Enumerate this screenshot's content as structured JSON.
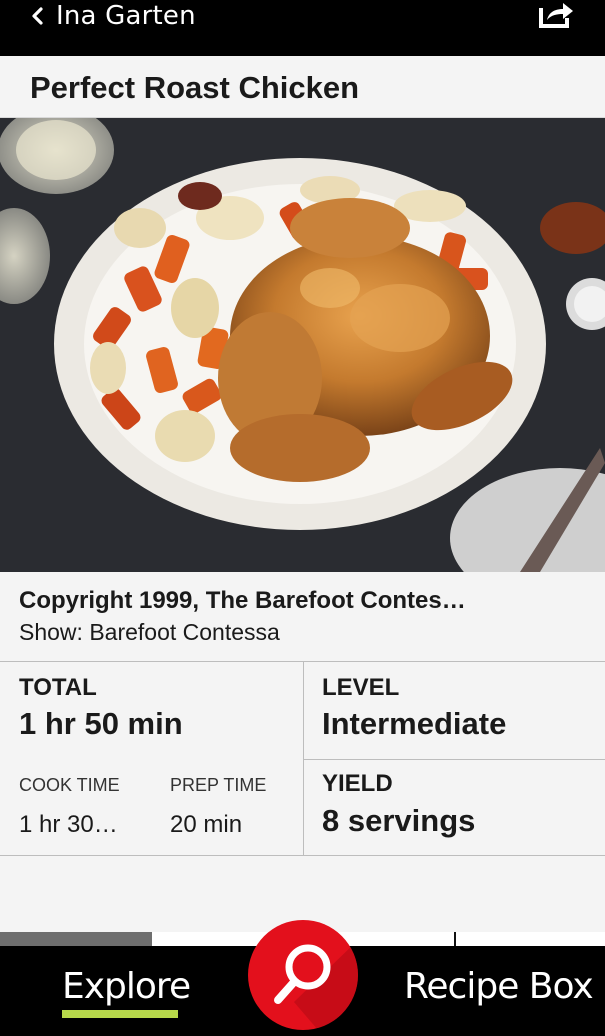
{
  "nav": {
    "back_label": "Ina Garten",
    "back_icon": "chevron-left-icon",
    "share_icon": "share-icon"
  },
  "recipe": {
    "title": "Perfect Roast Chicken",
    "copyright": "Copyright 1999, The Barefoot Contes…",
    "show": "Show: Barefoot Contessa",
    "total_label": "TOTAL",
    "total_value": "1 hr 50 min",
    "cook_label": "COOK TIME",
    "cook_value": "1 hr 30…",
    "prep_label": "PREP TIME",
    "prep_value": "20 min",
    "level_label": "LEVEL",
    "level_value": "Intermediate",
    "yield_label": "YIELD",
    "yield_value": "8 servings"
  },
  "media": {
    "play_icon": "play-icon"
  },
  "tabs": {
    "explore": "Explore",
    "recipe_box": "Recipe Box",
    "search_icon": "search-icon"
  },
  "colors": {
    "accent_red": "#e3101c",
    "explore_underline": "#b7d84b",
    "bar_bg": "#000000"
  }
}
